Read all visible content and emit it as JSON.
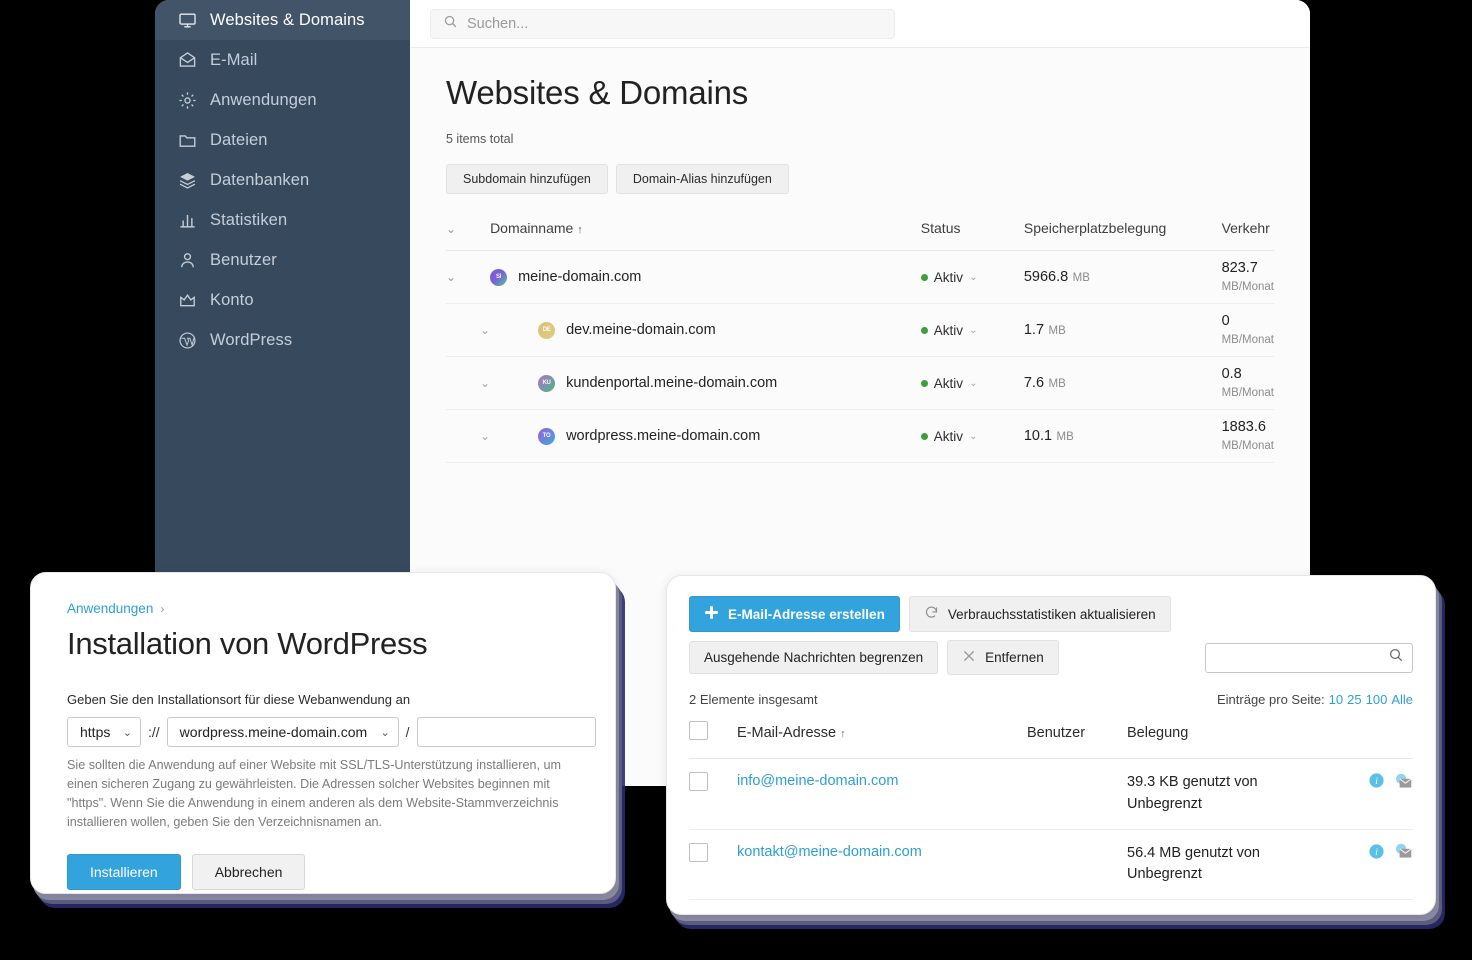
{
  "sidebar": {
    "items": [
      {
        "label": "Websites & Domains",
        "icon": "monitor-icon",
        "active": true
      },
      {
        "label": "E-Mail",
        "icon": "envelope-icon",
        "active": false
      },
      {
        "label": "Anwendungen",
        "icon": "gear-icon",
        "active": false
      },
      {
        "label": "Dateien",
        "icon": "folder-icon",
        "active": false
      },
      {
        "label": "Datenbanken",
        "icon": "layers-icon",
        "active": false
      },
      {
        "label": "Statistiken",
        "icon": "bar-chart-icon",
        "active": false
      },
      {
        "label": "Benutzer",
        "icon": "user-icon",
        "active": false
      },
      {
        "label": "Konto",
        "icon": "crown-icon",
        "active": false
      },
      {
        "label": "WordPress",
        "icon": "wordpress-icon",
        "active": false
      }
    ]
  },
  "topbar": {
    "search_placeholder": "Suchen..."
  },
  "page": {
    "title": "Websites & Domains",
    "items_total": "5 items total",
    "buttons": [
      {
        "label": "Subdomain hinzufügen"
      },
      {
        "label": "Domain-Alias hinzufügen"
      }
    ]
  },
  "domain_table": {
    "headers": {
      "name": "Domainname",
      "name_sort": "↑",
      "status": "Status",
      "space": "Speicherplatzbelegung",
      "traffic": "Verkehr"
    },
    "rows": [
      {
        "name": "meine-domain.com",
        "initials": "SI",
        "avatar_color": "#7c5fd6",
        "avatar_color2": "#4fc3a1",
        "sub": false,
        "status": "Aktiv",
        "space_value": "5966.8",
        "space_unit": "MB",
        "traffic_value": "823.7",
        "traffic_unit": "MB/Monat"
      },
      {
        "name": "dev.meine-domain.com",
        "initials": "DE",
        "avatar_color": "#d8c274",
        "avatar_color2": "#e0cb80",
        "sub": true,
        "status": "Aktiv",
        "space_value": "1.7",
        "space_unit": "MB",
        "traffic_value": "0",
        "traffic_unit": "MB/Monat"
      },
      {
        "name": "kundenportal.meine-domain.com",
        "initials": "KU",
        "avatar_color": "#b06fd0",
        "avatar_color2": "#49b97f",
        "sub": true,
        "status": "Aktiv",
        "space_value": "7.6",
        "space_unit": "MB",
        "traffic_value": "0.8",
        "traffic_unit": "MB/Monat"
      },
      {
        "name": "wordpress.meine-domain.com",
        "initials": "TO",
        "avatar_color": "#9b5fd6",
        "avatar_color2": "#3fa9e0",
        "sub": true,
        "status": "Aktiv",
        "space_value": "10.1",
        "space_unit": "MB",
        "traffic_value": "1883.6",
        "traffic_unit": "MB/Monat"
      }
    ]
  },
  "wp_dialog": {
    "breadcrumb": "Anwendungen",
    "breadcrumb_arrow": "›",
    "title": "Installation von WordPress",
    "field_label": "Geben Sie den Installationsort für diese Webanwendung an",
    "protocol": "https",
    "separator": "://",
    "domain": "wordpress.meine-domain.com",
    "slash": "/",
    "path_value": "",
    "description": "Sie sollten die Anwendung auf einer Website mit SSL/TLS-Unterstützung installieren, um einen sicheren Zugang zu gewährleisten. Die Adressen solcher Websites beginnen mit \"https\". Wenn Sie die Anwendung in einem anderen als dem Website-Stammverzeichnis installieren wollen, geben Sie den Verzeichnisnamen an.",
    "install_label": "Installieren",
    "cancel_label": "Abbrechen"
  },
  "mail_panel": {
    "buttons": {
      "create": "E-Mail-Adresse erstellen",
      "refresh_stats": "Verbrauchsstatistiken aktualisieren",
      "limit_outgoing": "Ausgehende Nachrichten begrenzen",
      "remove": "Entfernen"
    },
    "search_value": "",
    "items_total": "2 Elemente insgesamt",
    "per_page_label": "Einträge pro Seite:",
    "per_page_options": [
      "10",
      "25",
      "100",
      "Alle"
    ],
    "headers": {
      "address": "E-Mail-Adresse",
      "address_sort": "↑",
      "user": "Benutzer",
      "usage": "Belegung"
    },
    "rows": [
      {
        "address": "info@meine-domain.com",
        "user": "",
        "usage": "39.3 KB genutzt von Unbegrenzt"
      },
      {
        "address": "kontakt@meine-domain.com",
        "user": "",
        "usage": "56.4 MB genutzt von Unbegrenzt"
      }
    ]
  },
  "colors": {
    "sidebar_bg": "#37495d",
    "sidebar_active": "#415468",
    "accent_blue": "#32a3dd",
    "status_green": "#3c9f3c",
    "link_blue": "#2e9fd4"
  }
}
